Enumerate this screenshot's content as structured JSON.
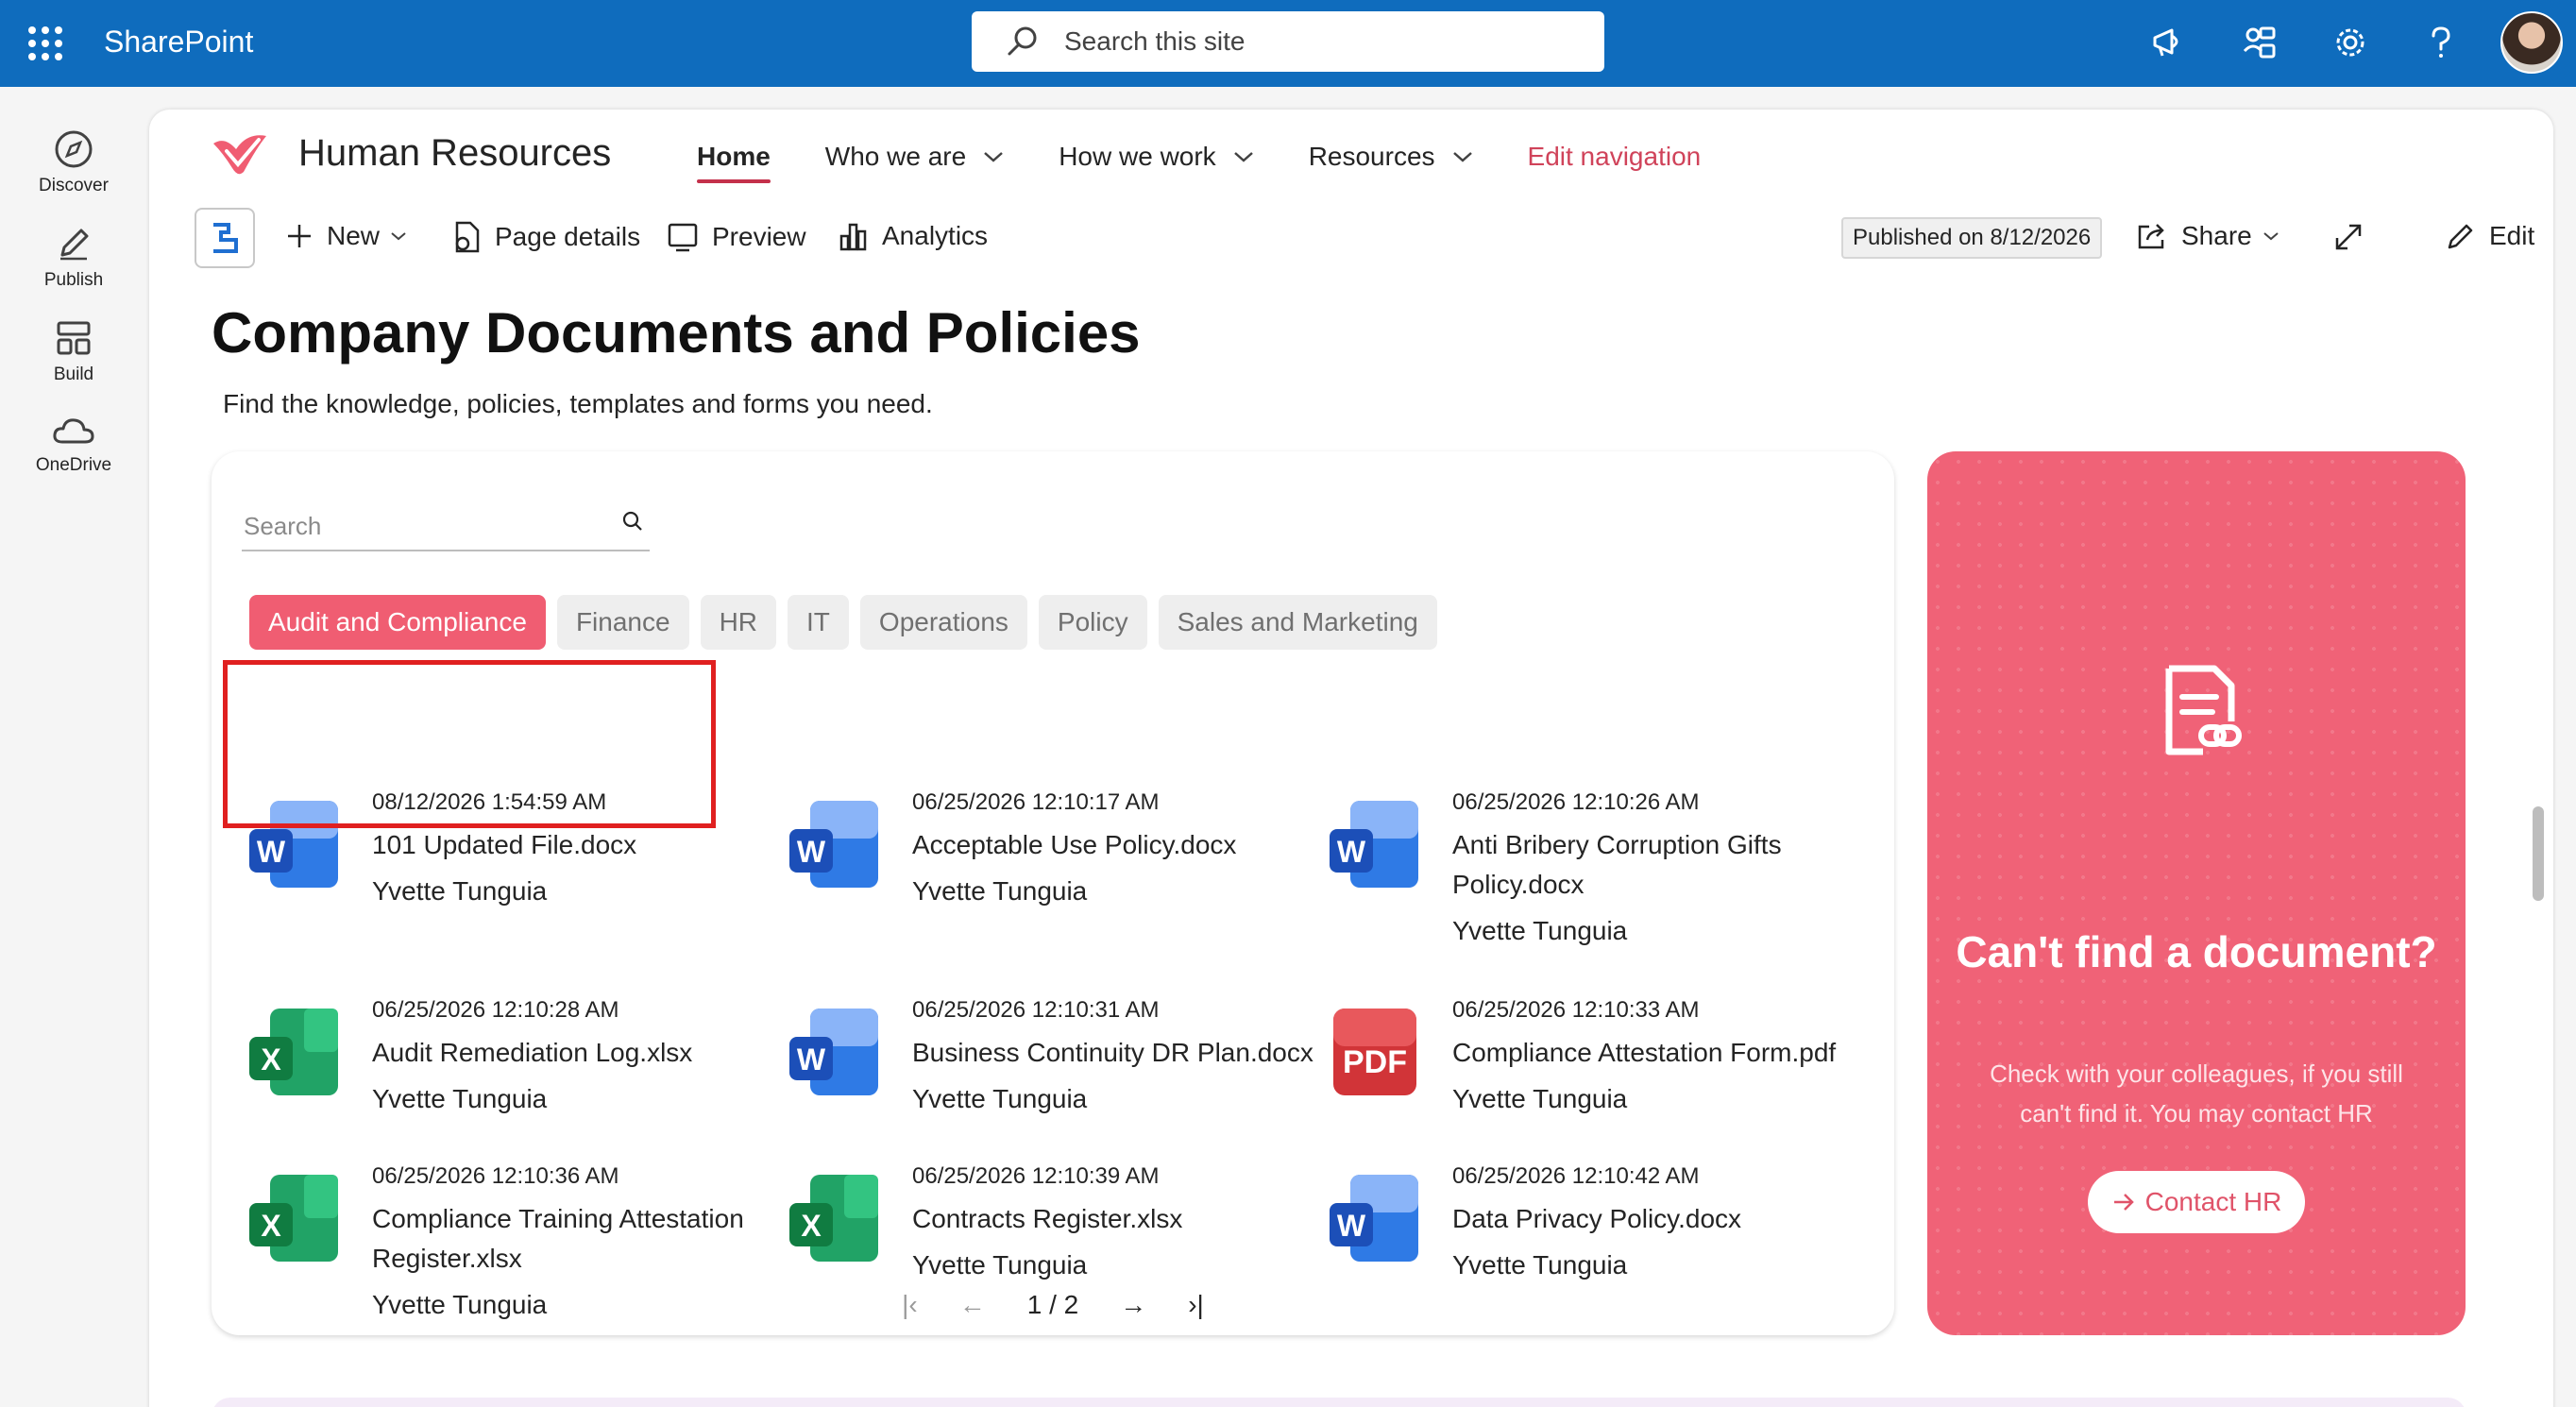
{
  "suite": {
    "brand": "SharePoint",
    "search_placeholder": "Search this site"
  },
  "appbar": {
    "items": [
      {
        "label": "Discover"
      },
      {
        "label": "Publish"
      },
      {
        "label": "Build"
      },
      {
        "label": "OneDrive"
      }
    ]
  },
  "site": {
    "title": "Human Resources",
    "nav": [
      {
        "label": "Home"
      },
      {
        "label": "Who we are"
      },
      {
        "label": "How we work"
      },
      {
        "label": "Resources"
      },
      {
        "label": "Edit navigation"
      }
    ]
  },
  "commands": {
    "new": "New",
    "page_details": "Page details",
    "preview": "Preview",
    "analytics": "Analytics",
    "published": "Published on 8/12/2026",
    "share": "Share",
    "edit": "Edit"
  },
  "page": {
    "title": "Company Documents and Policies",
    "subtitle": "Find the knowledge, policies, templates and forms you need."
  },
  "documents": {
    "search_placeholder": "Search",
    "categories": [
      "Audit and Compliance",
      "Finance",
      "HR",
      "IT",
      "Operations",
      "Policy",
      "Sales and Marketing"
    ],
    "active_category": "Audit and Compliance",
    "items": [
      {
        "date": "08/12/2026 1:54:59 AM",
        "name": "101 Updated File.docx",
        "author": "Yvette Tunguia",
        "type": "word"
      },
      {
        "date": "06/25/2026 12:10:17 AM",
        "name": "Acceptable Use Policy.docx",
        "author": "Yvette Tunguia",
        "type": "word"
      },
      {
        "date": "06/25/2026 12:10:26 AM",
        "name": "Anti Bribery Corruption Gifts Policy.docx",
        "author": "Yvette Tunguia",
        "type": "word"
      },
      {
        "date": "06/25/2026 12:10:28 AM",
        "name": "Audit Remediation Log.xlsx",
        "author": "Yvette Tunguia",
        "type": "excel"
      },
      {
        "date": "06/25/2026 12:10:31 AM",
        "name": "Business Continuity DR Plan.docx",
        "author": "Yvette Tunguia",
        "type": "word"
      },
      {
        "date": "06/25/2026 12:10:33 AM",
        "name": "Compliance Attestation Form.pdf",
        "author": "Yvette Tunguia",
        "type": "pdf"
      },
      {
        "date": "06/25/2026 12:10:36 AM",
        "name": "Compliance Training Attestation Register.xlsx",
        "author": "Yvette Tunguia",
        "type": "excel"
      },
      {
        "date": "06/25/2026 12:10:39 AM",
        "name": "Contracts Register.xlsx",
        "author": "Yvette Tunguia",
        "type": "excel"
      },
      {
        "date": "06/25/2026 12:10:42 AM",
        "name": "Data Privacy Policy.docx",
        "author": "Yvette Tunguia",
        "type": "word"
      }
    ],
    "pager": "1 / 2"
  },
  "promo": {
    "title": "Can't find a document?",
    "text": "Check with your colleagues, if you still can't find it. You may contact HR",
    "button": "Contact HR"
  },
  "colors": {
    "suitebar": "#0f6cbd",
    "accent": "#f05d72",
    "promo": "#f06277",
    "highlight": "#e02020"
  }
}
